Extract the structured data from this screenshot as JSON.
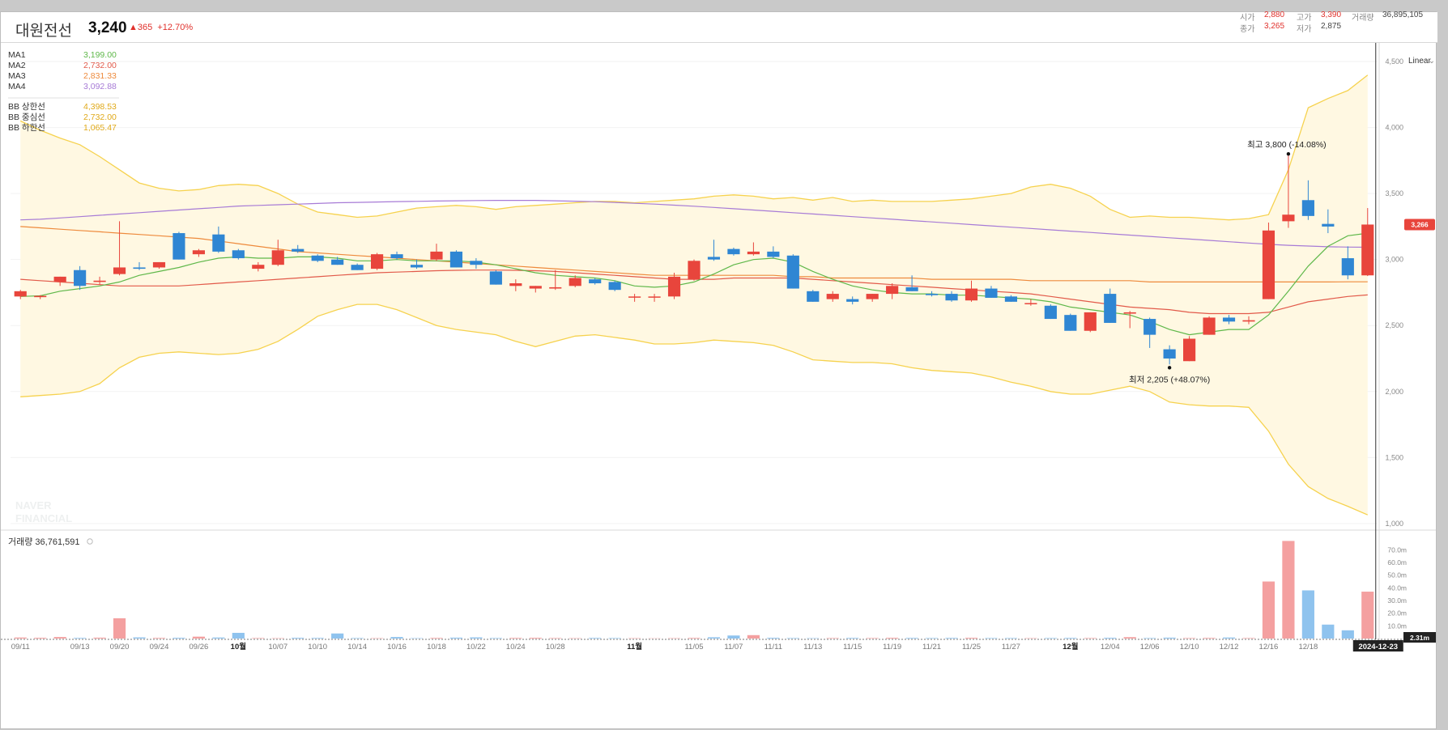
{
  "header": {
    "name": "대원전선",
    "price": "3,240",
    "change_arrow": "▲",
    "change_abs": "365",
    "change_pct": "+12.70%",
    "open_label": "시가",
    "open_value": "2,880",
    "high_label": "고가",
    "high_value": "3,390",
    "close_label": "종가",
    "close_value": "3,265",
    "low_label": "저가",
    "low_value": "2,875",
    "volume_label": "거래량",
    "volume_value": "36,895,105"
  },
  "legend": {
    "ma": [
      {
        "label": "MA1",
        "value": "3,199.00",
        "color": "#5fb84a"
      },
      {
        "label": "MA2",
        "value": "2,732.00",
        "color": "#e25a4a"
      },
      {
        "label": "MA3",
        "value": "2,831.33",
        "color": "#ee8a3c"
      },
      {
        "label": "MA4",
        "value": "3,092.88",
        "color": "#a77bd6"
      }
    ],
    "bb": [
      {
        "label": "BB 상한선",
        "value": "4,398.53",
        "color": "#e0a919"
      },
      {
        "label": "BB 중심선",
        "value": "2,732.00",
        "color": "#e0a919"
      },
      {
        "label": "BB 하한선",
        "value": "1,065.47",
        "color": "#e0a919"
      }
    ]
  },
  "scale_mode": "Linear",
  "volume_label": "거래량 36,761,591",
  "watermark": [
    "NAVER",
    "FINANCIAL"
  ],
  "crosshair_date": "2024-12-23",
  "crosshair_volume_tag": "2.31m",
  "annotations": {
    "high": "최고 3,800 (-14.08%)",
    "low": "최저 2,205 (+48.07%)"
  },
  "colors": {
    "up": "#e8453c",
    "down": "#2f86d3",
    "band_fill": "#fff8e2",
    "band_line": "#f6d24e"
  },
  "chart_data": {
    "type": "candlestick",
    "price_ticks": [
      1000,
      1500,
      2000,
      2500,
      3000,
      3500,
      4000,
      4500
    ],
    "price_tick_labels": [
      "1,000",
      "1,500",
      "2,000",
      "2,500",
      "3,000",
      "3,500",
      "4,000",
      "4,500"
    ],
    "price_ylim": [
      950,
      4580
    ],
    "last_price_tag": "3,266",
    "volume_ticks": [
      10,
      20,
      30,
      40,
      50,
      60,
      70
    ],
    "volume_tick_labels": [
      "10.0m",
      "20.0m",
      "30.0m",
      "40.0m",
      "50.0m",
      "60.0m",
      "70.0m"
    ],
    "x_labels": [
      "09/11",
      "09/13",
      "09/20",
      "09/24",
      "09/26",
      "10월",
      "10/07",
      "10/10",
      "10/14",
      "10/16",
      "10/18",
      "10/22",
      "10/24",
      "10/28",
      "11월",
      "11/05",
      "11/07",
      "11/11",
      "11/13",
      "11/15",
      "11/19",
      "11/21",
      "11/25",
      "11/27",
      "12월",
      "12/04",
      "12/06",
      "12/10",
      "12/12",
      "12/16",
      "12/18"
    ],
    "candles": [
      {
        "o": 2720,
        "h": 2770,
        "l": 2700,
        "c": 2760
      },
      {
        "o": 2715,
        "h": 2730,
        "l": 2700,
        "c": 2725
      },
      {
        "o": 2830,
        "h": 2870,
        "l": 2800,
        "c": 2870
      },
      {
        "o": 2920,
        "h": 2950,
        "l": 2770,
        "c": 2800
      },
      {
        "o": 2830,
        "h": 2870,
        "l": 2810,
        "c": 2840
      },
      {
        "o": 2890,
        "h": 3290,
        "l": 2880,
        "c": 2940
      },
      {
        "o": 2940,
        "h": 2980,
        "l": 2920,
        "c": 2930
      },
      {
        "o": 2940,
        "h": 2980,
        "l": 2930,
        "c": 2980
      },
      {
        "o": 3200,
        "h": 3210,
        "l": 3000,
        "c": 3000
      },
      {
        "o": 3040,
        "h": 3080,
        "l": 3020,
        "c": 3070
      },
      {
        "o": 3190,
        "h": 3250,
        "l": 3050,
        "c": 3060
      },
      {
        "o": 3070,
        "h": 3080,
        "l": 3000,
        "c": 3010
      },
      {
        "o": 2930,
        "h": 2980,
        "l": 2910,
        "c": 2960
      },
      {
        "o": 2960,
        "h": 3150,
        "l": 2950,
        "c": 3070
      },
      {
        "o": 3080,
        "h": 3110,
        "l": 3050,
        "c": 3060
      },
      {
        "o": 3030,
        "h": 3040,
        "l": 2980,
        "c": 2990
      },
      {
        "o": 3000,
        "h": 3020,
        "l": 2960,
        "c": 2960
      },
      {
        "o": 2960,
        "h": 2970,
        "l": 2920,
        "c": 2920
      },
      {
        "o": 2930,
        "h": 3050,
        "l": 2920,
        "c": 3040
      },
      {
        "o": 3040,
        "h": 3060,
        "l": 3000,
        "c": 3010
      },
      {
        "o": 2960,
        "h": 3000,
        "l": 2930,
        "c": 2940
      },
      {
        "o": 3000,
        "h": 3120,
        "l": 2990,
        "c": 3060
      },
      {
        "o": 3060,
        "h": 3070,
        "l": 2940,
        "c": 2940
      },
      {
        "o": 2990,
        "h": 3010,
        "l": 2930,
        "c": 2960
      },
      {
        "o": 2910,
        "h": 2920,
        "l": 2810,
        "c": 2810
      },
      {
        "o": 2800,
        "h": 2850,
        "l": 2760,
        "c": 2820
      },
      {
        "o": 2780,
        "h": 2800,
        "l": 2750,
        "c": 2800
      },
      {
        "o": 2780,
        "h": 2920,
        "l": 2770,
        "c": 2790
      },
      {
        "o": 2800,
        "h": 2880,
        "l": 2790,
        "c": 2860
      },
      {
        "o": 2850,
        "h": 2860,
        "l": 2810,
        "c": 2820
      },
      {
        "o": 2830,
        "h": 2840,
        "l": 2760,
        "c": 2770
      },
      {
        "o": 2720,
        "h": 2740,
        "l": 2680,
        "c": 2720
      },
      {
        "o": 2720,
        "h": 2740,
        "l": 2680,
        "c": 2720
      },
      {
        "o": 2720,
        "h": 2900,
        "l": 2700,
        "c": 2870
      },
      {
        "o": 2850,
        "h": 3000,
        "l": 2840,
        "c": 2990
      },
      {
        "o": 3020,
        "h": 3150,
        "l": 2990,
        "c": 3000
      },
      {
        "o": 3080,
        "h": 3090,
        "l": 3030,
        "c": 3040
      },
      {
        "o": 3040,
        "h": 3130,
        "l": 3030,
        "c": 3060
      },
      {
        "o": 3060,
        "h": 3100,
        "l": 3010,
        "c": 3020
      },
      {
        "o": 3030,
        "h": 3040,
        "l": 2780,
        "c": 2780
      },
      {
        "o": 2760,
        "h": 2770,
        "l": 2680,
        "c": 2680
      },
      {
        "o": 2700,
        "h": 2760,
        "l": 2680,
        "c": 2740
      },
      {
        "o": 2700,
        "h": 2720,
        "l": 2660,
        "c": 2680
      },
      {
        "o": 2700,
        "h": 2740,
        "l": 2680,
        "c": 2740
      },
      {
        "o": 2740,
        "h": 2820,
        "l": 2700,
        "c": 2800
      },
      {
        "o": 2790,
        "h": 2880,
        "l": 2760,
        "c": 2760
      },
      {
        "o": 2740,
        "h": 2760,
        "l": 2720,
        "c": 2730
      },
      {
        "o": 2740,
        "h": 2760,
        "l": 2680,
        "c": 2690
      },
      {
        "o": 2690,
        "h": 2840,
        "l": 2680,
        "c": 2780
      },
      {
        "o": 2780,
        "h": 2800,
        "l": 2710,
        "c": 2710
      },
      {
        "o": 2720,
        "h": 2730,
        "l": 2680,
        "c": 2680
      },
      {
        "o": 2670,
        "h": 2700,
        "l": 2650,
        "c": 2670
      },
      {
        "o": 2650,
        "h": 2660,
        "l": 2550,
        "c": 2550
      },
      {
        "o": 2580,
        "h": 2590,
        "l": 2460,
        "c": 2460
      },
      {
        "o": 2460,
        "h": 2600,
        "l": 2450,
        "c": 2600
      },
      {
        "o": 2740,
        "h": 2780,
        "l": 2520,
        "c": 2520
      },
      {
        "o": 2590,
        "h": 2610,
        "l": 2480,
        "c": 2600
      },
      {
        "o": 2550,
        "h": 2560,
        "l": 2330,
        "c": 2430
      },
      {
        "o": 2320,
        "h": 2350,
        "l": 2205,
        "c": 2250
      },
      {
        "o": 2230,
        "h": 2420,
        "l": 2230,
        "c": 2400
      },
      {
        "o": 2430,
        "h": 2570,
        "l": 2430,
        "c": 2560
      },
      {
        "o": 2560,
        "h": 2580,
        "l": 2510,
        "c": 2530
      },
      {
        "o": 2530,
        "h": 2570,
        "l": 2510,
        "c": 2540
      },
      {
        "o": 2700,
        "h": 3280,
        "l": 2700,
        "c": 3220
      },
      {
        "o": 3290,
        "h": 3800,
        "l": 3240,
        "c": 3340
      },
      {
        "o": 3450,
        "h": 3600,
        "l": 3300,
        "c": 3330
      },
      {
        "o": 3270,
        "h": 3380,
        "l": 3200,
        "c": 3250
      },
      {
        "o": 3010,
        "h": 3100,
        "l": 2850,
        "c": 2880
      },
      {
        "o": 2880,
        "h": 3390,
        "l": 2875,
        "c": 3265
      }
    ],
    "ma1": [
      2720,
      2725,
      2760,
      2780,
      2800,
      2830,
      2880,
      2910,
      2940,
      2980,
      3010,
      3020,
      3010,
      3010,
      3020,
      3020,
      3010,
      2990,
      2990,
      3000,
      2990,
      2990,
      2990,
      2980,
      2960,
      2930,
      2900,
      2880,
      2870,
      2860,
      2840,
      2800,
      2790,
      2800,
      2830,
      2890,
      2960,
      3000,
      3010,
      2980,
      2910,
      2850,
      2800,
      2770,
      2750,
      2740,
      2740,
      2730,
      2730,
      2720,
      2710,
      2700,
      2680,
      2640,
      2620,
      2600,
      2580,
      2530,
      2470,
      2430,
      2450,
      2470,
      2470,
      2580,
      2760,
      2950,
      3100,
      3180,
      3200
    ],
    "ma2": [
      2850,
      2840,
      2830,
      2820,
      2810,
      2800,
      2800,
      2800,
      2800,
      2810,
      2820,
      2830,
      2840,
      2850,
      2860,
      2870,
      2880,
      2890,
      2900,
      2905,
      2910,
      2915,
      2918,
      2920,
      2920,
      2918,
      2915,
      2910,
      2900,
      2890,
      2880,
      2870,
      2860,
      2850,
      2850,
      2850,
      2860,
      2860,
      2860,
      2860,
      2850,
      2840,
      2830,
      2820,
      2810,
      2800,
      2790,
      2780,
      2770,
      2760,
      2750,
      2740,
      2720,
      2700,
      2680,
      2660,
      2640,
      2630,
      2620,
      2600,
      2590,
      2590,
      2590,
      2600,
      2640,
      2680,
      2700,
      2720,
      2732
    ],
    "ma3": [
      3250,
      3240,
      3230,
      3220,
      3210,
      3200,
      3190,
      3180,
      3170,
      3160,
      3140,
      3120,
      3100,
      3080,
      3060,
      3050,
      3040,
      3030,
      3020,
      3010,
      3000,
      2990,
      2980,
      2970,
      2960,
      2950,
      2940,
      2930,
      2920,
      2910,
      2900,
      2890,
      2880,
      2880,
      2880,
      2880,
      2880,
      2880,
      2880,
      2870,
      2870,
      2860,
      2860,
      2860,
      2860,
      2860,
      2850,
      2850,
      2850,
      2850,
      2850,
      2840,
      2840,
      2840,
      2840,
      2840,
      2840,
      2830,
      2830,
      2830,
      2830,
      2830,
      2830,
      2830,
      2830,
      2830,
      2830,
      2831,
      2831
    ],
    "ma4": [
      3300,
      3305,
      3315,
      3325,
      3335,
      3345,
      3355,
      3365,
      3375,
      3385,
      3395,
      3405,
      3410,
      3415,
      3420,
      3425,
      3430,
      3433,
      3436,
      3439,
      3441,
      3443,
      3445,
      3447,
      3448,
      3448,
      3448,
      3445,
      3442,
      3438,
      3432,
      3426,
      3420,
      3412,
      3404,
      3395,
      3385,
      3375,
      3365,
      3355,
      3345,
      3335,
      3325,
      3315,
      3305,
      3295,
      3285,
      3275,
      3265,
      3255,
      3245,
      3235,
      3225,
      3215,
      3205,
      3195,
      3185,
      3175,
      3165,
      3155,
      3145,
      3135,
      3125,
      3115,
      3108,
      3102,
      3097,
      3094,
      3093
    ],
    "bb_upper": [
      4050,
      3980,
      3920,
      3870,
      3780,
      3680,
      3580,
      3540,
      3520,
      3530,
      3560,
      3570,
      3560,
      3500,
      3420,
      3360,
      3340,
      3320,
      3330,
      3360,
      3390,
      3400,
      3410,
      3400,
      3380,
      3400,
      3410,
      3420,
      3430,
      3440,
      3440,
      3430,
      3440,
      3450,
      3460,
      3480,
      3490,
      3480,
      3460,
      3470,
      3450,
      3470,
      3440,
      3450,
      3440,
      3440,
      3440,
      3450,
      3460,
      3480,
      3500,
      3550,
      3570,
      3540,
      3480,
      3380,
      3320,
      3330,
      3320,
      3320,
      3310,
      3300,
      3310,
      3340,
      3680,
      4150,
      4220,
      4280,
      4398
    ],
    "bb_lower": [
      1960,
      1970,
      1980,
      2000,
      2060,
      2180,
      2260,
      2290,
      2300,
      2290,
      2280,
      2290,
      2320,
      2380,
      2470,
      2570,
      2620,
      2660,
      2660,
      2620,
      2560,
      2500,
      2470,
      2450,
      2430,
      2380,
      2340,
      2380,
      2420,
      2430,
      2410,
      2390,
      2360,
      2360,
      2370,
      2390,
      2380,
      2370,
      2350,
      2300,
      2240,
      2230,
      2220,
      2220,
      2210,
      2180,
      2160,
      2150,
      2140,
      2110,
      2070,
      2040,
      2000,
      1980,
      1980,
      2010,
      2040,
      2000,
      1920,
      1900,
      1890,
      1890,
      1880,
      1700,
      1450,
      1280,
      1190,
      1130,
      1065
    ],
    "volumes": [
      0.8,
      0.6,
      1.2,
      0.5,
      0.7,
      16,
      0.9,
      0.5,
      0.6,
      1.5,
      0.8,
      4.5,
      0.4,
      0.3,
      0.6,
      0.5,
      4,
      0.4,
      0.3,
      1.2,
      0.3,
      0.5,
      0.7,
      0.9,
      0.4,
      0.5,
      0.6,
      0.4,
      0.3,
      0.5,
      0.4,
      0.3,
      0.2,
      0.3,
      0.5,
      1.0,
      2.4,
      2.7,
      0.6,
      0.4,
      0.3,
      0.4,
      0.5,
      0.4,
      0.6,
      0.5,
      0.4,
      0.5,
      0.6,
      0.4,
      0.4,
      0.3,
      0.4,
      0.5,
      0.4,
      0.6,
      1.1,
      0.4,
      0.7,
      0.4,
      0.5,
      0.8,
      0.4,
      45,
      77,
      38,
      11,
      6.5,
      37
    ],
    "x_label_idx": [
      0,
      3,
      5,
      7,
      9,
      11,
      13,
      15,
      17,
      19,
      21,
      23,
      25,
      27,
      31,
      34,
      36,
      38,
      40,
      42,
      44,
      46,
      48,
      50,
      53,
      55,
      57,
      59,
      61,
      63,
      65
    ]
  }
}
